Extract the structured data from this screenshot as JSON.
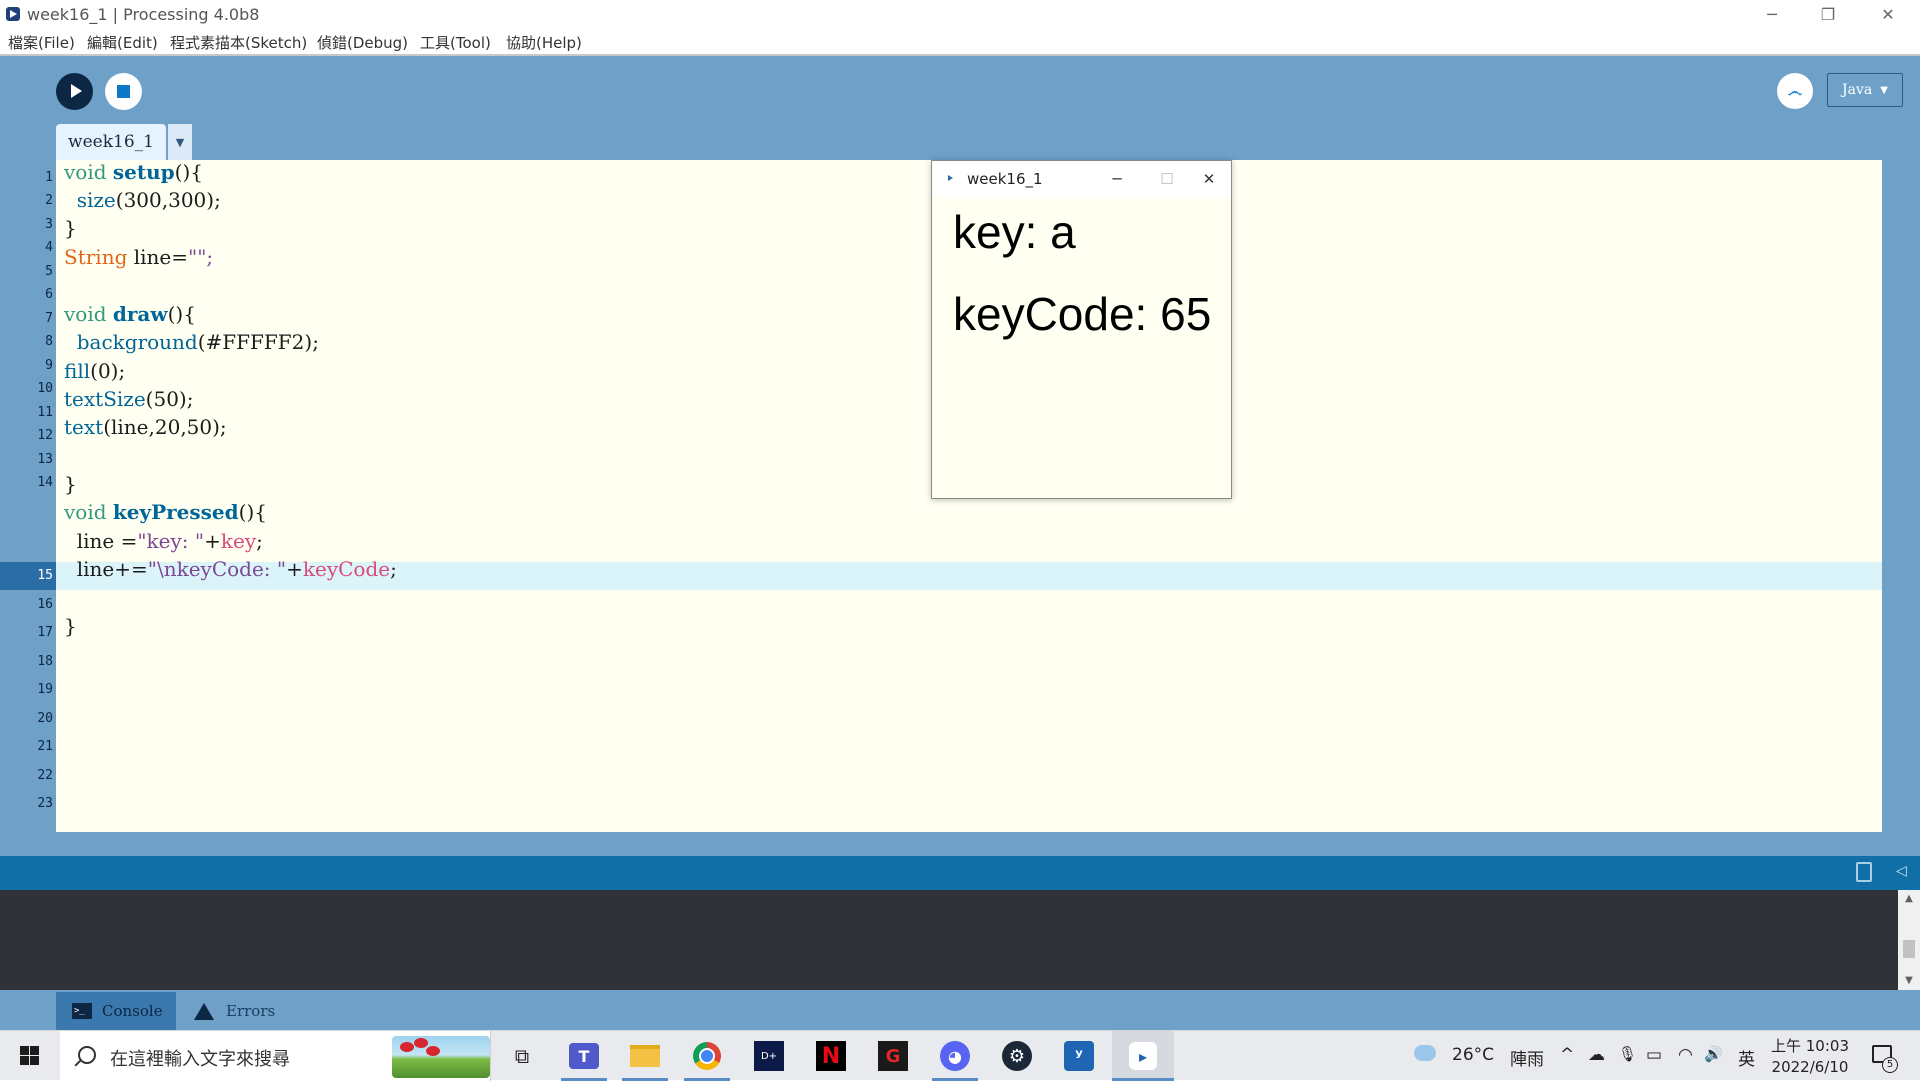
{
  "window": {
    "title": "week16_1 | Processing 4.0b8",
    "minimize_glyph": "─",
    "maximize_glyph": "❐",
    "close_glyph": "✕"
  },
  "menu": {
    "items": [
      "檔案(File)",
      "編輯(Edit)",
      "程式素描本(Sketch)",
      "偵錯(Debug)",
      "工具(Tool)",
      "協助(Help)"
    ]
  },
  "toolbar": {
    "run_icon": "play-icon",
    "stop_icon": "stop-icon",
    "debug_icon": "butterfly-debug-icon",
    "debug_glyph": "෴",
    "mode_label": "Java",
    "mode_arrow": "▼"
  },
  "tabs": {
    "active_tab": "week16_1",
    "menu_arrow": "▼"
  },
  "editor": {
    "line_numbers": [
      "1",
      "2",
      "3",
      "4",
      "5",
      "6",
      "7",
      "8",
      "9",
      "10",
      "11",
      "12",
      "13",
      "14",
      "15",
      "16",
      "17",
      "18",
      "19",
      "20",
      "21",
      "22",
      "23"
    ],
    "current_line": "15",
    "code": {
      "l1": {
        "t1": "void",
        "t2": " ",
        "t3": "setup",
        "t4": "(){"
      },
      "l2": {
        "t1": "  ",
        "t2": "size",
        "t3": "(300,300);"
      },
      "l3": {
        "t1": "}"
      },
      "l4": {
        "t1": "String",
        "t2": " line=",
        "t3": "\"\";"
      },
      "l6": {
        "t1": "void",
        "t2": " ",
        "t3": "draw",
        "t4": "(){"
      },
      "l7": {
        "t1": "  ",
        "t2": "background",
        "t3": "(#FFFFF2);"
      },
      "l8": {
        "t1": "fill",
        "t2": "(0);"
      },
      "l9": {
        "t1": "textSize",
        "t2": "(50);"
      },
      "l10": {
        "t1": "text",
        "t2": "(line,20,50);"
      },
      "l12": {
        "t1": "}"
      },
      "l13": {
        "t1": "void",
        "t2": " ",
        "t3": "keyPressed",
        "t4": "(){"
      },
      "l14": {
        "t1": "  line =",
        "t2": "\"key: \"",
        "t3": "+",
        "t4": "key",
        "t5": ";"
      },
      "l15": {
        "t1": "  line+=",
        "t2": "\"\\nkeyCode: \"",
        "t3": "+",
        "t4": "keyCode",
        "t5": ";"
      },
      "l17": {
        "t1": "}"
      }
    }
  },
  "sketch_window": {
    "title": "week16_1",
    "minimize_glyph": "─",
    "maximize_glyph": "☐",
    "close_glyph": "✕",
    "output_line1": "key: a",
    "output_line2": "keyCode: 65"
  },
  "console": {
    "console_tab": "Console",
    "errors_tab": "Errors",
    "console_icon_glyph": ">_",
    "scroll_up": "▲",
    "scroll_down": "▼",
    "toggle_glyph": "◁"
  },
  "taskbar": {
    "search_placeholder": "在這裡輸入文字來搜尋",
    "task_view_glyph": "⧉",
    "weather_temp": "26°C",
    "weather_desc": "陣雨",
    "tray_chevron": "^",
    "tray_cloud": "☁",
    "tray_mic": "🎙",
    "tray_battery": "▭",
    "tray_wifi": "◠",
    "tray_volume": "🔊",
    "ime": "英",
    "time": "上午 10:03",
    "date": "2022/6/10",
    "notification_count": "5",
    "apps": {
      "teams": "T",
      "chrome": "◉",
      "disney": "D+",
      "netflix": "N",
      "garena": "G",
      "discord": "◕",
      "steam": "⚙",
      "vscode": "ʸ",
      "processing": "▸"
    }
  },
  "colors": {
    "toolbar_bg": "#6ea0c8",
    "editor_bg": "#fffff2",
    "keyword": "#33997e",
    "function": "#006699",
    "type": "#e2661a",
    "string": "#7d4793",
    "variable": "#d94a7a",
    "console_bg": "#2f3236",
    "console_bar": "#0f6fa6"
  }
}
